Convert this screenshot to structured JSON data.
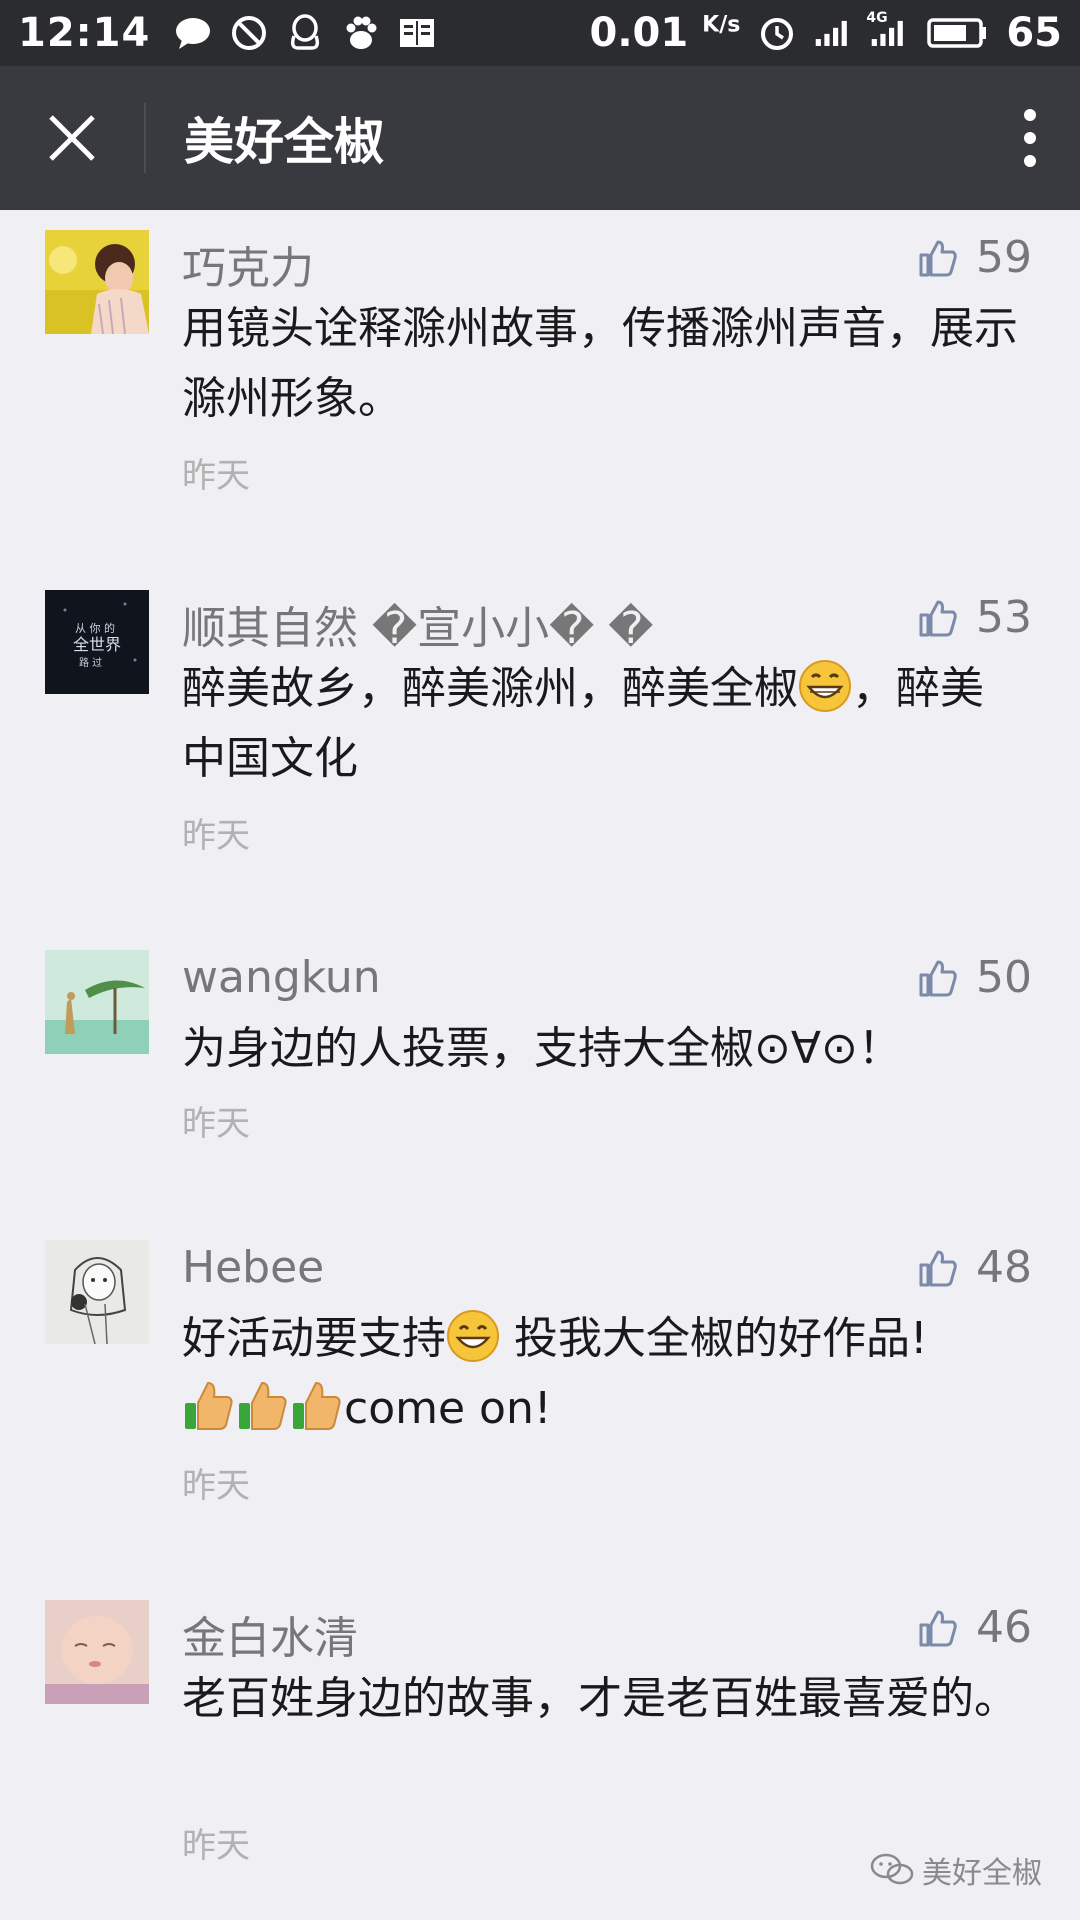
{
  "status_bar": {
    "time": "12:14",
    "speed": "0.01",
    "speed_unit": "K/s",
    "network": "4G",
    "battery": "65"
  },
  "nav": {
    "title": "美好全椒"
  },
  "comments": [
    {
      "name": "巧克力",
      "likes": "59",
      "text": "用镜头诠释滁州故事，传播滁州声音，展示滁州形象。",
      "time": "昨天"
    },
    {
      "name": "顺其自然 �宣小小� �",
      "likes": "53",
      "text_a": "醉美故乡，醉美滁州，醉美全椒",
      "text_b": "，醉美中国文化",
      "time": "昨天"
    },
    {
      "name": "wangkun",
      "likes": "50",
      "text": "为身边的人投票，支持大全椒⊙∀⊙！",
      "time": "昨天"
    },
    {
      "name": "Hebee",
      "likes": "48",
      "text_a": "好活动要支持",
      "text_b": " 投我大全椒的好作品!",
      "text_c": "come on!",
      "time": "昨天"
    },
    {
      "name": "金白水清",
      "likes": "46",
      "text": "老百姓身边的故事，才是老百姓最喜爱的。",
      "time": "昨天"
    }
  ],
  "avatar_texts": {
    "comment_2": [
      "从 你 的",
      "全世界",
      "路 过"
    ]
  },
  "watermark": "美好全椒",
  "icons": {
    "like": "thumbs-up-icon",
    "close": "close-icon",
    "more": "more-vertical-icon"
  },
  "colors": {
    "status_bar": "#2b2c30",
    "nav_bar": "#393a3f",
    "background": "#efeff4",
    "name_text": "#777777",
    "time_text": "#b2b2b2"
  }
}
